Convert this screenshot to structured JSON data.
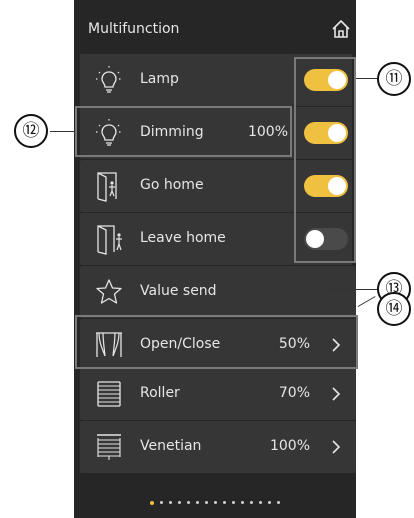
{
  "header": {
    "title": "Multifunction",
    "home_icon": "home-icon"
  },
  "items": [
    {
      "label": "Lamp",
      "icon": "bulb-icon",
      "value": "",
      "toggle": "on"
    },
    {
      "label": "Dimming",
      "icon": "bulb-icon",
      "value": "100%",
      "toggle": "on"
    },
    {
      "label": "Go home",
      "icon": "door-enter-icon",
      "value": "",
      "toggle": "on"
    },
    {
      "label": "Leave home",
      "icon": "door-exit-icon",
      "value": "",
      "toggle": "off"
    },
    {
      "label": "Value send",
      "icon": "star-icon",
      "value": ""
    },
    {
      "label": "Open/Close",
      "icon": "curtain-icon",
      "value": "50%",
      "chevron": true
    },
    {
      "label": "Roller",
      "icon": "roller-blind-icon",
      "value": "70%",
      "chevron": true
    },
    {
      "label": "Venetian",
      "icon": "venetian-blind-icon",
      "value": "100%",
      "chevron": true
    }
  ],
  "callouts": {
    "c11": "⑪",
    "c12": "⑫",
    "c13": "⑬",
    "c14": "⑭"
  },
  "pager": {
    "pages": 15,
    "current": 1
  },
  "colors": {
    "accent": "#f0c040",
    "panel": "#262626",
    "row": "#363636",
    "text": "#e6e6e6"
  }
}
